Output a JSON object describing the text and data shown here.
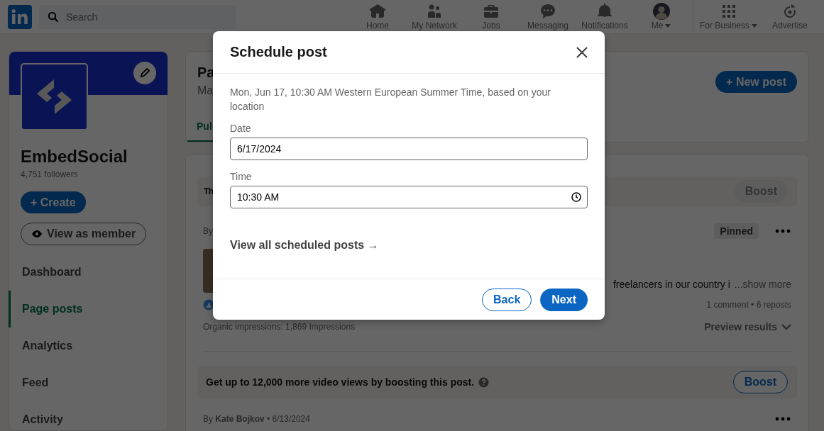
{
  "nav": {
    "search": {
      "placeholder": "Search"
    },
    "items": [
      {
        "label": "Home",
        "kind": "home",
        "dropdown": false
      },
      {
        "label": "My Network",
        "kind": "network",
        "dropdown": false
      },
      {
        "label": "Jobs",
        "kind": "jobs",
        "dropdown": false
      },
      {
        "label": "Messaging",
        "kind": "messaging",
        "dropdown": false
      },
      {
        "label": "Notifications",
        "kind": "notifications",
        "dropdown": false
      },
      {
        "label": "Me",
        "kind": "avatar",
        "dropdown": true
      },
      {
        "label": "For Business",
        "kind": "grid",
        "dropdown": true
      },
      {
        "label": "Advertise",
        "kind": "advertise",
        "dropdown": false
      }
    ]
  },
  "sidebar": {
    "name": "EmbedSocial",
    "followers": "4,751 followers",
    "create_button": "+ Create",
    "view_button": "View as member",
    "menu": [
      {
        "label": "Dashboard",
        "selected": false
      },
      {
        "label": "Page posts",
        "selected": true
      },
      {
        "label": "Analytics",
        "selected": false
      },
      {
        "label": "Feed",
        "selected": false
      },
      {
        "label": "Activity",
        "selected": false
      }
    ]
  },
  "main": {
    "title": "Pa",
    "subtitle": "Ma",
    "new_post_button": "+ New post",
    "tabs": [
      {
        "label": "Pul",
        "selected": true
      }
    ],
    "boost_bar": {
      "text": "Th",
      "button": "Boost",
      "disabled": true
    },
    "post": {
      "byline": "By",
      "badge": "Pinned",
      "text": "freelancers in our country i",
      "show_more": "...show more",
      "stats": "1 comment • 6 reposts",
      "impressions": "Organic impressions: 1,869 Impressions",
      "preview": "Preview results"
    },
    "promo": {
      "text": "Get up to 12,000 more video views by boosting this post.",
      "button": "Boost",
      "disabled": false
    },
    "next_post": {
      "byline": "By **Kate Bojkov** • 6/13/2024"
    }
  },
  "modal": {
    "title": "Schedule post",
    "note": "Mon, Jun 17, 10:30 AM Western European Summer Time, based on your location",
    "fields": [
      {
        "label": "Date",
        "value": "6/17/2024",
        "kind": "date"
      },
      {
        "label": "Time",
        "value": "10:30 AM",
        "kind": "time"
      }
    ],
    "link": "View all scheduled posts →",
    "buttons": [
      {
        "label": "Back",
        "kind": "secondary"
      },
      {
        "label": "Next",
        "kind": "primary"
      }
    ]
  }
}
